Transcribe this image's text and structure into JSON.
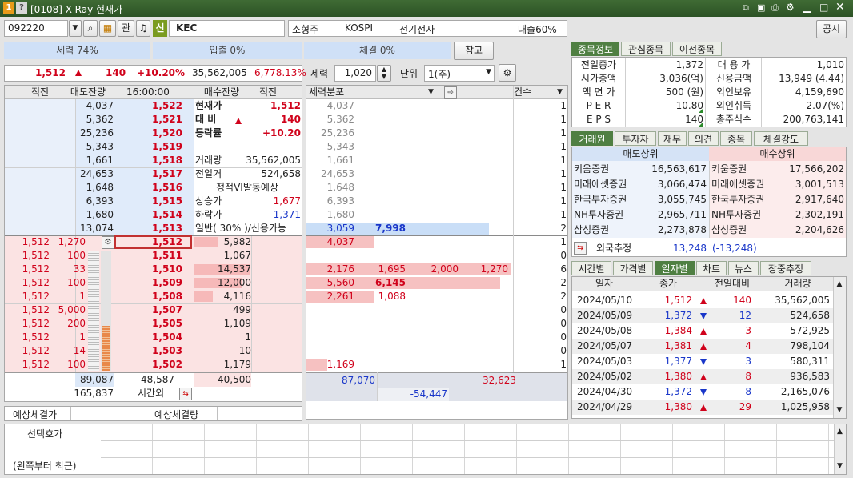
{
  "window": {
    "title": "[0108] X-Ray 현재가",
    "icon1": "1",
    "icon2": "?"
  },
  "search": {
    "code": "092220",
    "kwan": "관",
    "shin": "신",
    "name": "KEC"
  },
  "info": {
    "size": "소형주",
    "market": "KOSPI",
    "sector": "전기전자",
    "loan": "대출60%",
    "notice_btn": "공시"
  },
  "bars": {
    "power": "세력 74%",
    "inout": "입출 0%",
    "exec": "체결 0%",
    "ref_btn": "참고"
  },
  "price_line": {
    "price": "1,512",
    "change": "140",
    "rate": "+10.20%",
    "volume": "35,562,005",
    "ratio": "6,778.13%"
  },
  "ctrl": {
    "power_label": "세력",
    "power_val": "1,020",
    "unit_label": "단위",
    "unit_val": "1(주)"
  },
  "ob_header": {
    "c1": "직전",
    "c2": "매도잔량",
    "time": "16:00:00",
    "c4": "매수잔량",
    "c5": "직전"
  },
  "asks": [
    {
      "qty": "4,037",
      "price": "1,522",
      "lbl": "현재가",
      "val": "1,512"
    },
    {
      "qty": "5,362",
      "price": "1,521",
      "lbl": "대 비",
      "val": "140"
    },
    {
      "qty": "25,236",
      "price": "1,520",
      "lbl": "등락률",
      "val": "+10.20"
    },
    {
      "qty": "5,343",
      "price": "1,519",
      "lbl": "",
      "val": ""
    },
    {
      "qty": "1,661",
      "price": "1,518",
      "lbl": "거래량",
      "val": "35,562,005"
    },
    {
      "qty": "24,653",
      "price": "1,517",
      "lbl": "전일거",
      "val": "524,658"
    },
    {
      "qty": "1,648",
      "price": "1,516",
      "lbl": "정적VI발동예상",
      "val": ""
    },
    {
      "qty": "6,393",
      "price": "1,515",
      "lbl": "상승가",
      "val": "1,677"
    },
    {
      "qty": "1,680",
      "price": "1,514",
      "lbl": "하락가",
      "val": "1,371"
    },
    {
      "qty": "13,074",
      "price": "1,513",
      "lbl": "일반( 30% )/신용가능",
      "val": ""
    }
  ],
  "bids": [
    {
      "prev": "1,512",
      "tick": "1,270",
      "price": "1,512",
      "qty": "5,982"
    },
    {
      "prev": "1,512",
      "tick": "100",
      "price": "1,511",
      "qty": "1,067"
    },
    {
      "prev": "1,512",
      "tick": "33",
      "price": "1,510",
      "qty": "14,537"
    },
    {
      "prev": "1,512",
      "tick": "100",
      "price": "1,509",
      "qty": "12,000"
    },
    {
      "prev": "1,512",
      "tick": "1",
      "price": "1,508",
      "qty": "4,116"
    },
    {
      "prev": "1,512",
      "tick": "5,000",
      "price": "1,507",
      "qty": "499"
    },
    {
      "prev": "1,512",
      "tick": "200",
      "price": "1,505",
      "qty": "1,109"
    },
    {
      "prev": "1,512",
      "tick": "1",
      "price": "1,504",
      "qty": "1"
    },
    {
      "prev": "1,512",
      "tick": "14",
      "price": "1,503",
      "qty": "10"
    },
    {
      "prev": "1,512",
      "tick": "100",
      "price": "1,502",
      "qty": "1,179"
    }
  ],
  "ob_footer": {
    "ask_total": "89,087",
    "diff": "-48,587",
    "bid_total": "40,500",
    "after": "165,837",
    "after_lbl": "시간외"
  },
  "expected": {
    "price_lbl": "예상체결가",
    "qty_lbl": "예상체결량"
  },
  "dist": {
    "header": "세력분포",
    "count_header": "건수",
    "ask_rows": [
      {
        "v1": "4,037",
        "cnt": "1"
      },
      {
        "v1": "5,362",
        "cnt": "1"
      },
      {
        "v1": "25,236",
        "cnt": "1"
      },
      {
        "v1": "5,343",
        "cnt": "1"
      },
      {
        "v1": "1,661",
        "cnt": "1"
      },
      {
        "v1": "24,653",
        "cnt": "1"
      },
      {
        "v1": "1,648",
        "cnt": "1"
      },
      {
        "v1": "6,393",
        "cnt": "1"
      },
      {
        "v1": "1,680",
        "cnt": "1"
      },
      {
        "v1": "3,059",
        "v2": "7,998",
        "cnt": "2"
      }
    ],
    "bid_rows": [
      {
        "v1": "4,037",
        "cnt": "1"
      },
      {
        "cnt": "0"
      },
      {
        "v1": "2,176",
        "v2": "1,695",
        "v3": "2,000",
        "v4": "1,270",
        "cnt": "6"
      },
      {
        "v1": "5,560",
        "v2": "6,145",
        "cnt": "2"
      },
      {
        "v1": "2,261",
        "v2": "1,088",
        "cnt": "2"
      },
      {
        "cnt": "0"
      },
      {
        "cnt": "0"
      },
      {
        "cnt": "0"
      },
      {
        "cnt": "0"
      },
      {
        "v1": "1,169",
        "cnt": "1"
      }
    ],
    "foot_left": "87,070",
    "foot_right": "32,623",
    "foot_diff": "-54,447"
  },
  "right_tabs1": [
    "종목정보",
    "관심종목",
    "이전종목"
  ],
  "stock_info": [
    {
      "l1": "전일종가",
      "v1": "1,372",
      "l2": "대 용 가",
      "v2": "1,010"
    },
    {
      "l1": "시가총액",
      "v1": "3,036(억)",
      "l2": "신용금액",
      "v2": "13,949  (4.44)"
    },
    {
      "l1": "액 면 가",
      "v1": "500 (원)",
      "l2": "외인보유",
      "v2": "4,159,690"
    },
    {
      "l1": "P E R",
      "v1": "10.80",
      "l2": "외인취득",
      "v2": "2.07(%)"
    },
    {
      "l1": "E P S",
      "v1": "140",
      "l2": "총주식수",
      "v2": "200,763,141"
    }
  ],
  "right_tabs2": [
    "거래원",
    "투자자",
    "재무",
    "의견",
    "종목",
    "체결강도"
  ],
  "brokers": {
    "sell_hdr": "매도상위",
    "buy_hdr": "매수상위",
    "rows": [
      {
        "s": "키움증권",
        "sv": "16,563,617",
        "b": "키움증권",
        "bv": "17,566,202"
      },
      {
        "s": "미래에셋증권",
        "sv": "3,066,474",
        "b": "미래에셋증권",
        "bv": "3,001,513"
      },
      {
        "s": "한국투자증권",
        "sv": "3,055,745",
        "b": "한국투자증권",
        "bv": "2,917,640"
      },
      {
        "s": "NH투자증권",
        "sv": "2,965,711",
        "b": "NH투자증권",
        "bv": "2,302,191"
      },
      {
        "s": "삼성증권",
        "sv": "2,273,878",
        "b": "삼성증권",
        "bv": "2,204,626"
      }
    ],
    "foreign_lbl": "외국추정",
    "foreign_sell": "13,248",
    "foreign_buy": "(-13,248)"
  },
  "right_tabs3": [
    "시간별",
    "가격별",
    "일자별",
    "차트",
    "뉴스",
    "장중추정"
  ],
  "daily": {
    "headers": [
      "일자",
      "종가",
      "전일대비",
      "거래량"
    ],
    "rows": [
      {
        "d": "2024/05/10",
        "p": "1,512",
        "dir": "up",
        "c": "140",
        "v": "35,562,005"
      },
      {
        "d": "2024/05/09",
        "p": "1,372",
        "dir": "down",
        "c": "12",
        "v": "524,658"
      },
      {
        "d": "2024/05/08",
        "p": "1,384",
        "dir": "up",
        "c": "3",
        "v": "572,925"
      },
      {
        "d": "2024/05/07",
        "p": "1,381",
        "dir": "up",
        "c": "4",
        "v": "798,104"
      },
      {
        "d": "2024/05/03",
        "p": "1,377",
        "dir": "down",
        "c": "3",
        "v": "580,311"
      },
      {
        "d": "2024/05/02",
        "p": "1,380",
        "dir": "up",
        "c": "8",
        "v": "936,583"
      },
      {
        "d": "2024/04/30",
        "p": "1,372",
        "dir": "down",
        "c": "8",
        "v": "2,165,076"
      },
      {
        "d": "2024/04/29",
        "p": "1,380",
        "dir": "up",
        "c": "29",
        "v": "1,025,958"
      }
    ]
  },
  "bottom": {
    "l1": "선택호가",
    "l2": "(왼쪽부터 최근)"
  }
}
